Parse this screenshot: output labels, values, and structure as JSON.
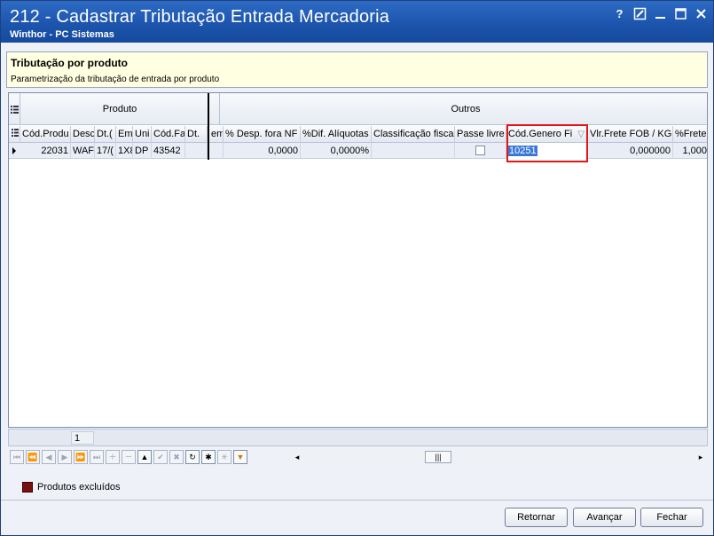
{
  "window": {
    "title": "212 - Cadastrar Tributação Entrada Mercadoria",
    "subtitle": "Winthor - PC Sistemas",
    "help": "?"
  },
  "header": {
    "title": "Tributação por produto",
    "description": "Parametrização da tributação de entrada por produto"
  },
  "grid": {
    "bands": {
      "produto": "Produto",
      "outros": "Outros"
    },
    "columns": [
      "Cód.Produ",
      "Desc",
      "Dt.(",
      "Em",
      "Uni",
      "Cód.Fa",
      "Dt.",
      "em",
      "% Desp. fora NF",
      "%Dif. Alíquotas",
      "Classificação fiscal",
      "Passe livre",
      "Cód.Genero Fi",
      "Vlr.Frete FOB / KG",
      "%Frete"
    ],
    "row": {
      "cod_produto": "22031",
      "descricao": "WAFI",
      "dt": "17/(",
      "em": "1X8",
      "uni": "DP",
      "cod_fab": "43542",
      "dt2": "",
      "em2": "",
      "desp_fora_nf": "0,0000",
      "dif_aliquotas": "0,0000%",
      "classificacao_fiscal": "",
      "cod_genero_fiscal": "10251",
      "vlr_frete_fob": "0,000000",
      "perc_frete": "1,000"
    }
  },
  "footer": {
    "count": "1"
  },
  "legend": {
    "label": "Produtos excluídos",
    "color": "#7a0f0f"
  },
  "buttons": {
    "retornar": "Retornar",
    "avancar": "Avançar",
    "fechar": "Fechar"
  },
  "colors": {
    "titlebar": "#1d55ad",
    "highlight_box": "#e01818",
    "selection": "#3a77d8"
  }
}
